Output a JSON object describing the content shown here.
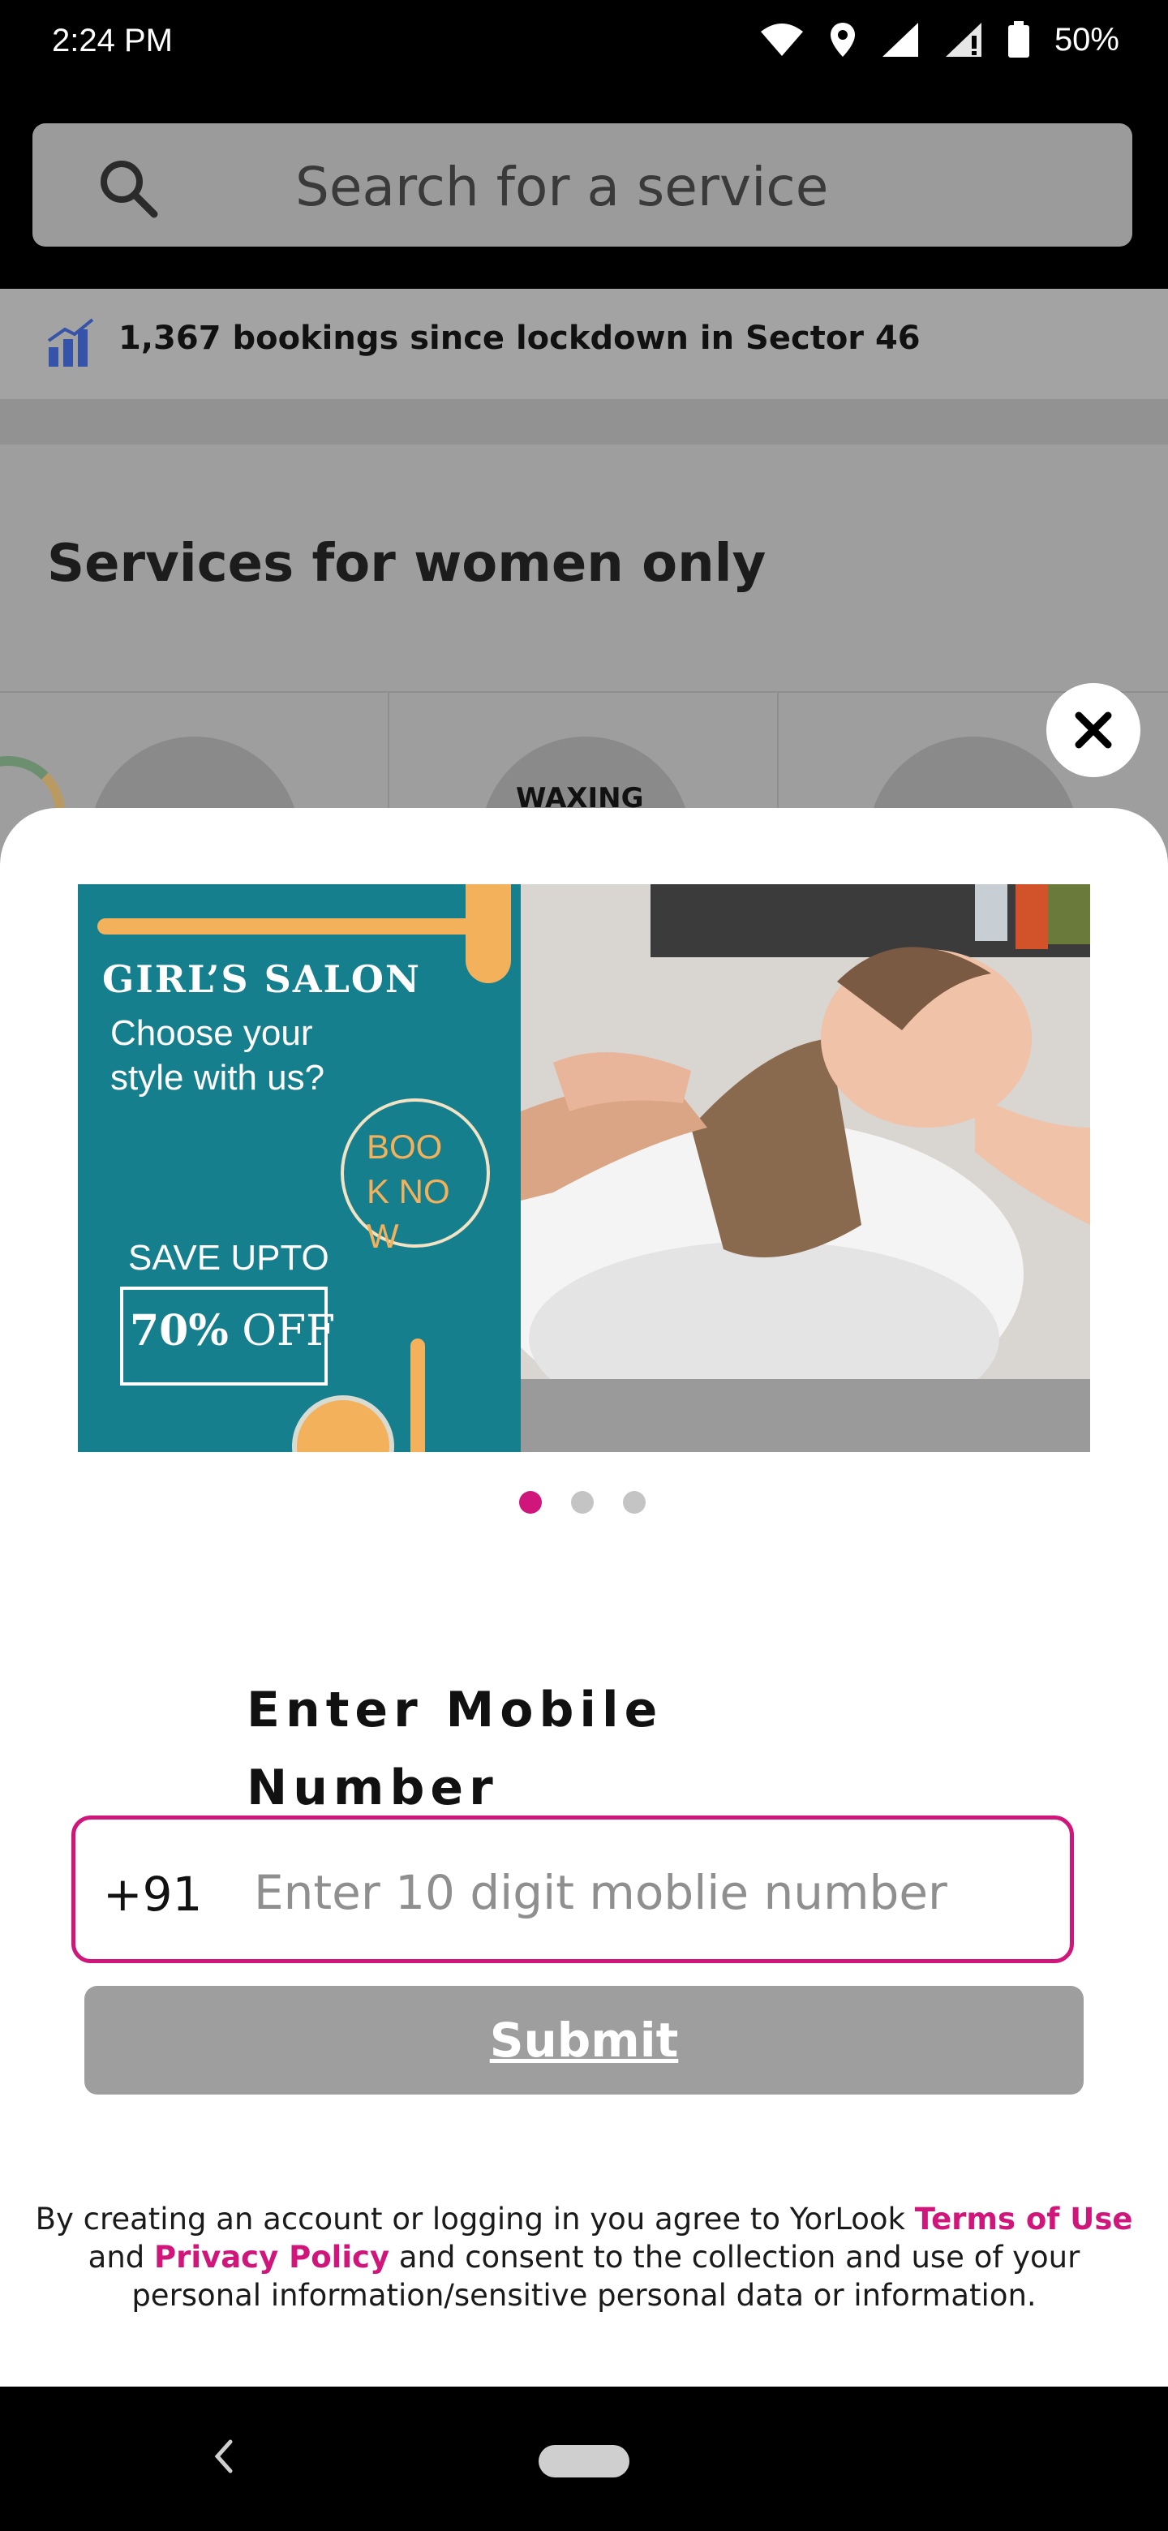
{
  "status_bar": {
    "time": "2:24 PM",
    "battery": "50%",
    "icons": [
      "wifi-icon",
      "location-icon",
      "signal-icon",
      "signal-alert-icon",
      "battery-icon"
    ]
  },
  "search": {
    "placeholder": "Search for a service",
    "icon": "search-icon"
  },
  "background": {
    "bookings_text": "1,367 bookings since lockdown in Sector 46",
    "section_title": "Services for women only",
    "tiles": [
      "WAXING"
    ]
  },
  "banner": {
    "title": "GIRL’S SALON",
    "subtitle": "Choose your style with us?",
    "cta": "BOOK NOW",
    "save_label": "SAVE UPTO",
    "offer_percent": "70%",
    "offer_word": "OFF",
    "slide_count": 3,
    "active_slide": 1
  },
  "form": {
    "label": "Enter Mobile Number",
    "country_code": "+91",
    "phone_placeholder": "Enter 10 digit moblie number",
    "phone_value": "",
    "submit_label": "Submit"
  },
  "legal": {
    "prefix": "By creating an account or logging in you agree to YorLook ",
    "terms": "Terms of Use",
    "and": " and ",
    "privacy": "Privacy Policy",
    "suffix": " and consent to the collection and use of your personal information/sensitive personal data or information."
  },
  "colors": {
    "accent": "#d1167b",
    "banner_teal": "#167f8d",
    "banner_orange": "#f2b15a",
    "button_gray": "#9e9e9e"
  }
}
